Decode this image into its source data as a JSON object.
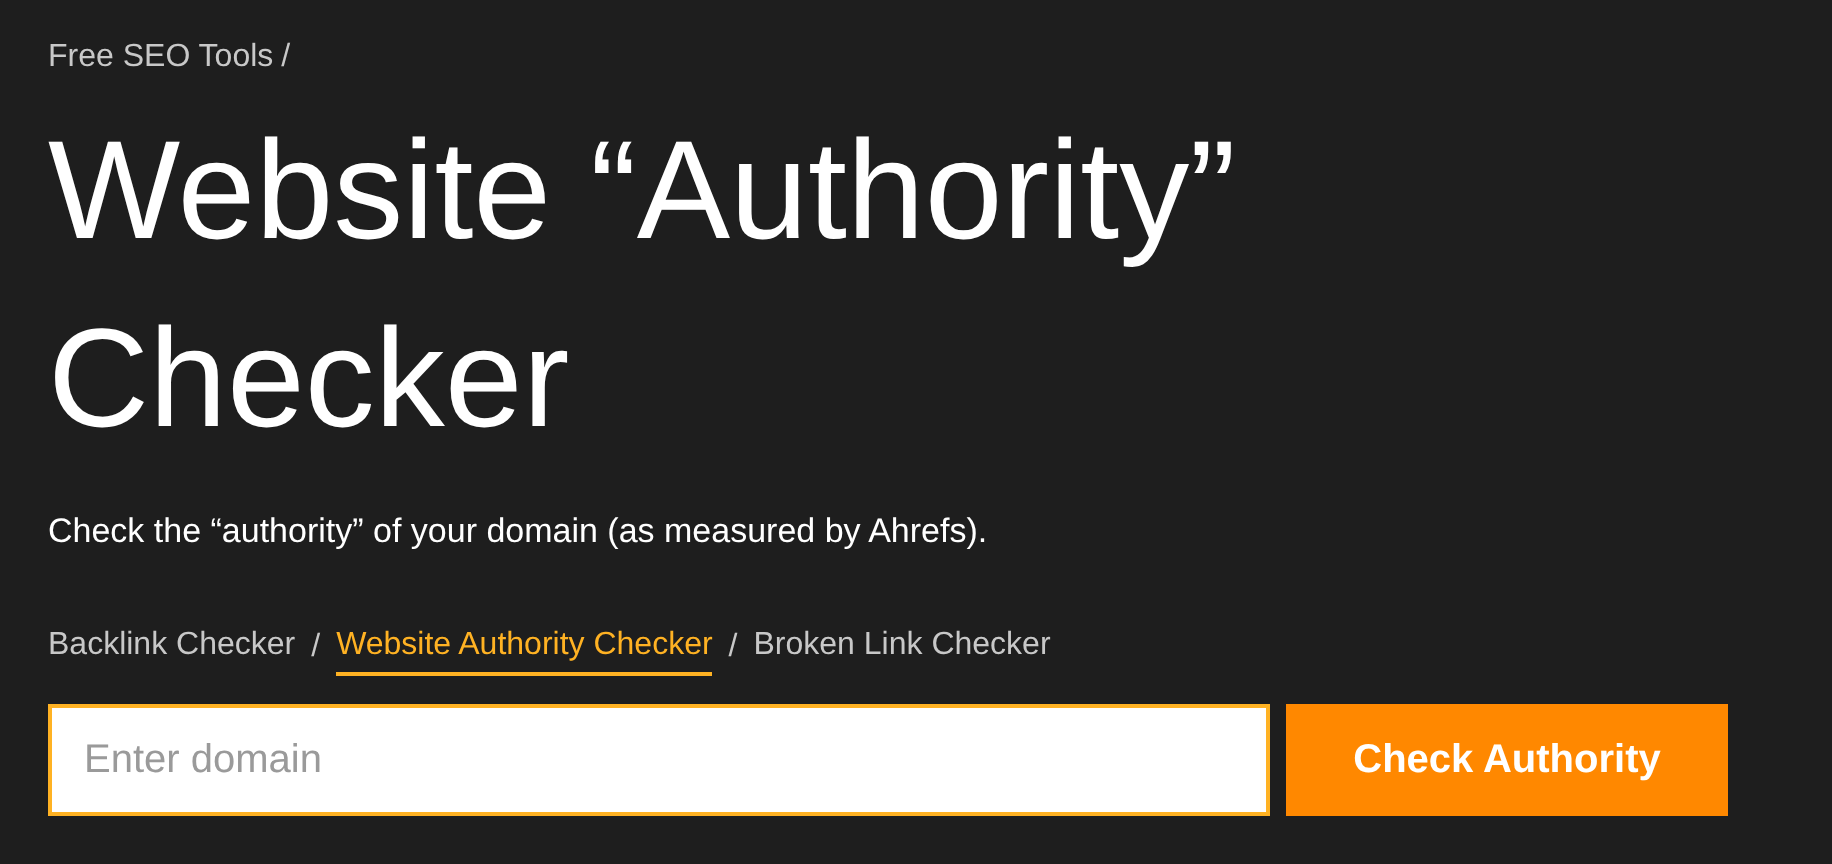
{
  "breadcrumb": {
    "link": "Free SEO Tools",
    "separator": "/"
  },
  "title": "Website “Authority” Checker",
  "description": "Check the “authority” of your domain (as measured by Ahrefs).",
  "tool_nav": [
    {
      "label": "Backlink Checker",
      "selected": false
    },
    {
      "label": "Website Authority Checker",
      "selected": true
    },
    {
      "label": "Broken Link Checker",
      "selected": false
    }
  ],
  "tool_nav_separator": "/",
  "search": {
    "placeholder": "Enter domain",
    "button": "Check Authority"
  }
}
